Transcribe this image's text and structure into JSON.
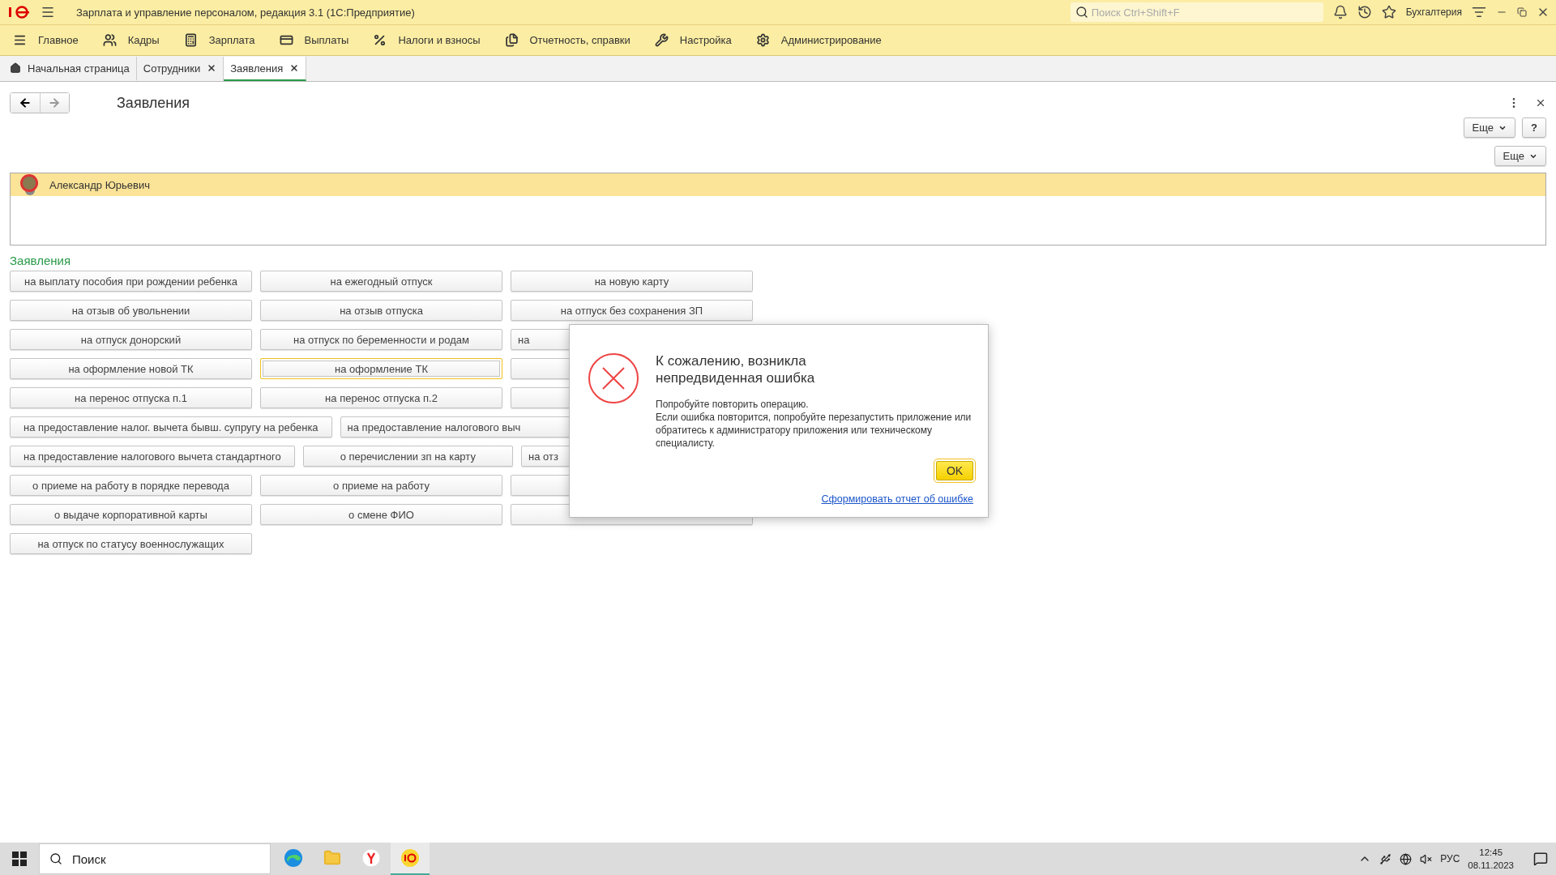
{
  "window": {
    "title": "Зарплата и управление персоналом, редакция 3.1  (1С:Предприятие)",
    "search_placeholder": "Поиск Ctrl+Shift+F",
    "user": "Бухгалтерия"
  },
  "sections": [
    "Главное",
    "Кадры",
    "Зарплата",
    "Выплаты",
    "Налоги и взносы",
    "Отчетность, справки",
    "Настройка",
    "Администрирование"
  ],
  "tabs": [
    {
      "label": "Начальная страница",
      "kind": "home",
      "selected": false
    },
    {
      "label": "Сотрудники",
      "kind": "closable",
      "selected": false
    },
    {
      "label": "Заявления",
      "kind": "closable",
      "selected": true
    }
  ],
  "form": {
    "title": "Заявления",
    "more_top": "Еще",
    "help": "?",
    "more_list": "Еще"
  },
  "employees": [
    {
      "name": "Александр Юрьевич",
      "selected": true
    }
  ],
  "requests_title": "Заявления",
  "request_rows": [
    [
      {
        "label": "на выплату пособия при рождении ребенка",
        "focused": false
      },
      {
        "label": "на ежегодный отпуск",
        "focused": false
      },
      {
        "label": "на новую карту",
        "focused": false
      }
    ],
    [
      {
        "label": "на отзыв об увольнении",
        "focused": false
      },
      {
        "label": "на отзыв отпуска",
        "focused": false
      },
      {
        "label": "на отпуск без сохранения ЗП",
        "focused": false
      }
    ],
    [
      {
        "label": "на отпуск донорский",
        "focused": false
      },
      {
        "label": "на отпуск по беременности и родам",
        "focused": false
      },
      {
        "label": "на",
        "kind": "covered",
        "focused": false
      }
    ],
    [
      {
        "label": "на оформление новой ТК",
        "focused": false
      },
      {
        "label": "на оформление ТК",
        "focused": true
      },
      {
        "focused": false
      }
    ],
    [
      {
        "label": "на перенос отпуска п.1",
        "focused": false
      },
      {
        "label": "на перенос отпуска п.2",
        "focused": false
      },
      {
        "focused": false
      }
    ],
    [
      {
        "label": "на предоставление налог. вычета бывш. супругу на ребенка",
        "focused": false
      },
      {
        "label": "на предоставление налогового выч",
        "kind": "covered",
        "focused": false
      }
    ],
    [
      {
        "label": "на предоставление налогового вычета стандартного",
        "focused": false
      },
      {
        "label": "о перечислении зп на карту",
        "focused": false
      },
      {
        "label": "на отз",
        "kind": "covered",
        "focused": false
      }
    ],
    [
      {
        "label": "о приеме на работу в порядке перевода",
        "focused": false
      },
      {
        "label": "о приеме на работу",
        "focused": false
      },
      {
        "focused": false
      }
    ],
    [
      {
        "label": "о выдаче корпоративной карты",
        "focused": false
      },
      {
        "label": "о смене ФИО",
        "focused": false
      },
      {
        "focused": false
      }
    ],
    [
      {
        "label": "на отпуск по статусу военнослужащих",
        "focused": false
      }
    ]
  ],
  "dialog": {
    "title": "К сожалению, возникла непредвиденная ошибка",
    "lines": [
      "Попробуйте повторить операцию.",
      "Если ошибка повторится, попробуйте перезапустить приложение или обратитесь к администратору приложения или техническому специалисту."
    ],
    "ok": "OK",
    "report_link": "Сформировать отчет об ошибке"
  },
  "taskbar": {
    "search": "Поиск",
    "apps": [
      {
        "kind": "edge",
        "selected": false
      },
      {
        "kind": "folder",
        "selected": false
      },
      {
        "kind": "yandex",
        "selected": false
      },
      {
        "kind": "onec",
        "selected": true
      }
    ],
    "lang": "РУС",
    "time": "12:45",
    "date": "08.11.2023"
  }
}
